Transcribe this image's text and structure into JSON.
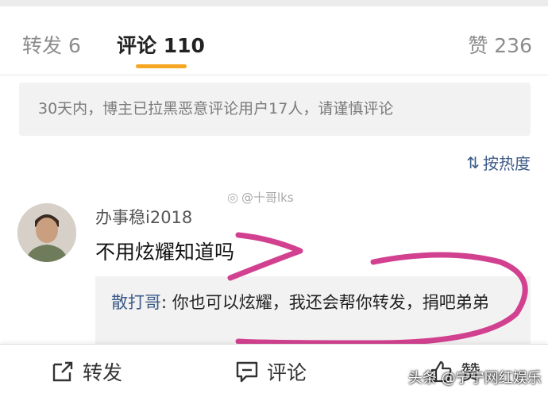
{
  "tabs": {
    "repost": "转发 6",
    "comment": "评论 110",
    "like": "赞 236"
  },
  "notice": "30天内，博主已拉黑恶意评论用户17人，请谨慎评论",
  "sort": {
    "icon": "sort-icon",
    "label": "按热度"
  },
  "watermark": "@十哥lks",
  "comment": {
    "username": "办事稳i2018",
    "text": "不用炫耀知道吗",
    "reply": {
      "user": "散打哥",
      "text": ": 你也可以炫耀，我还会帮你转发，捐吧弟弟"
    }
  },
  "bottom_bar": {
    "repost": "转发",
    "comment": "评论",
    "like": "赞"
  },
  "source_mark": "头条 @宁宁网红娱乐",
  "annotation_color": "#d2418f",
  "accent_color": "#f5a623",
  "link_color": "#3d5b88"
}
